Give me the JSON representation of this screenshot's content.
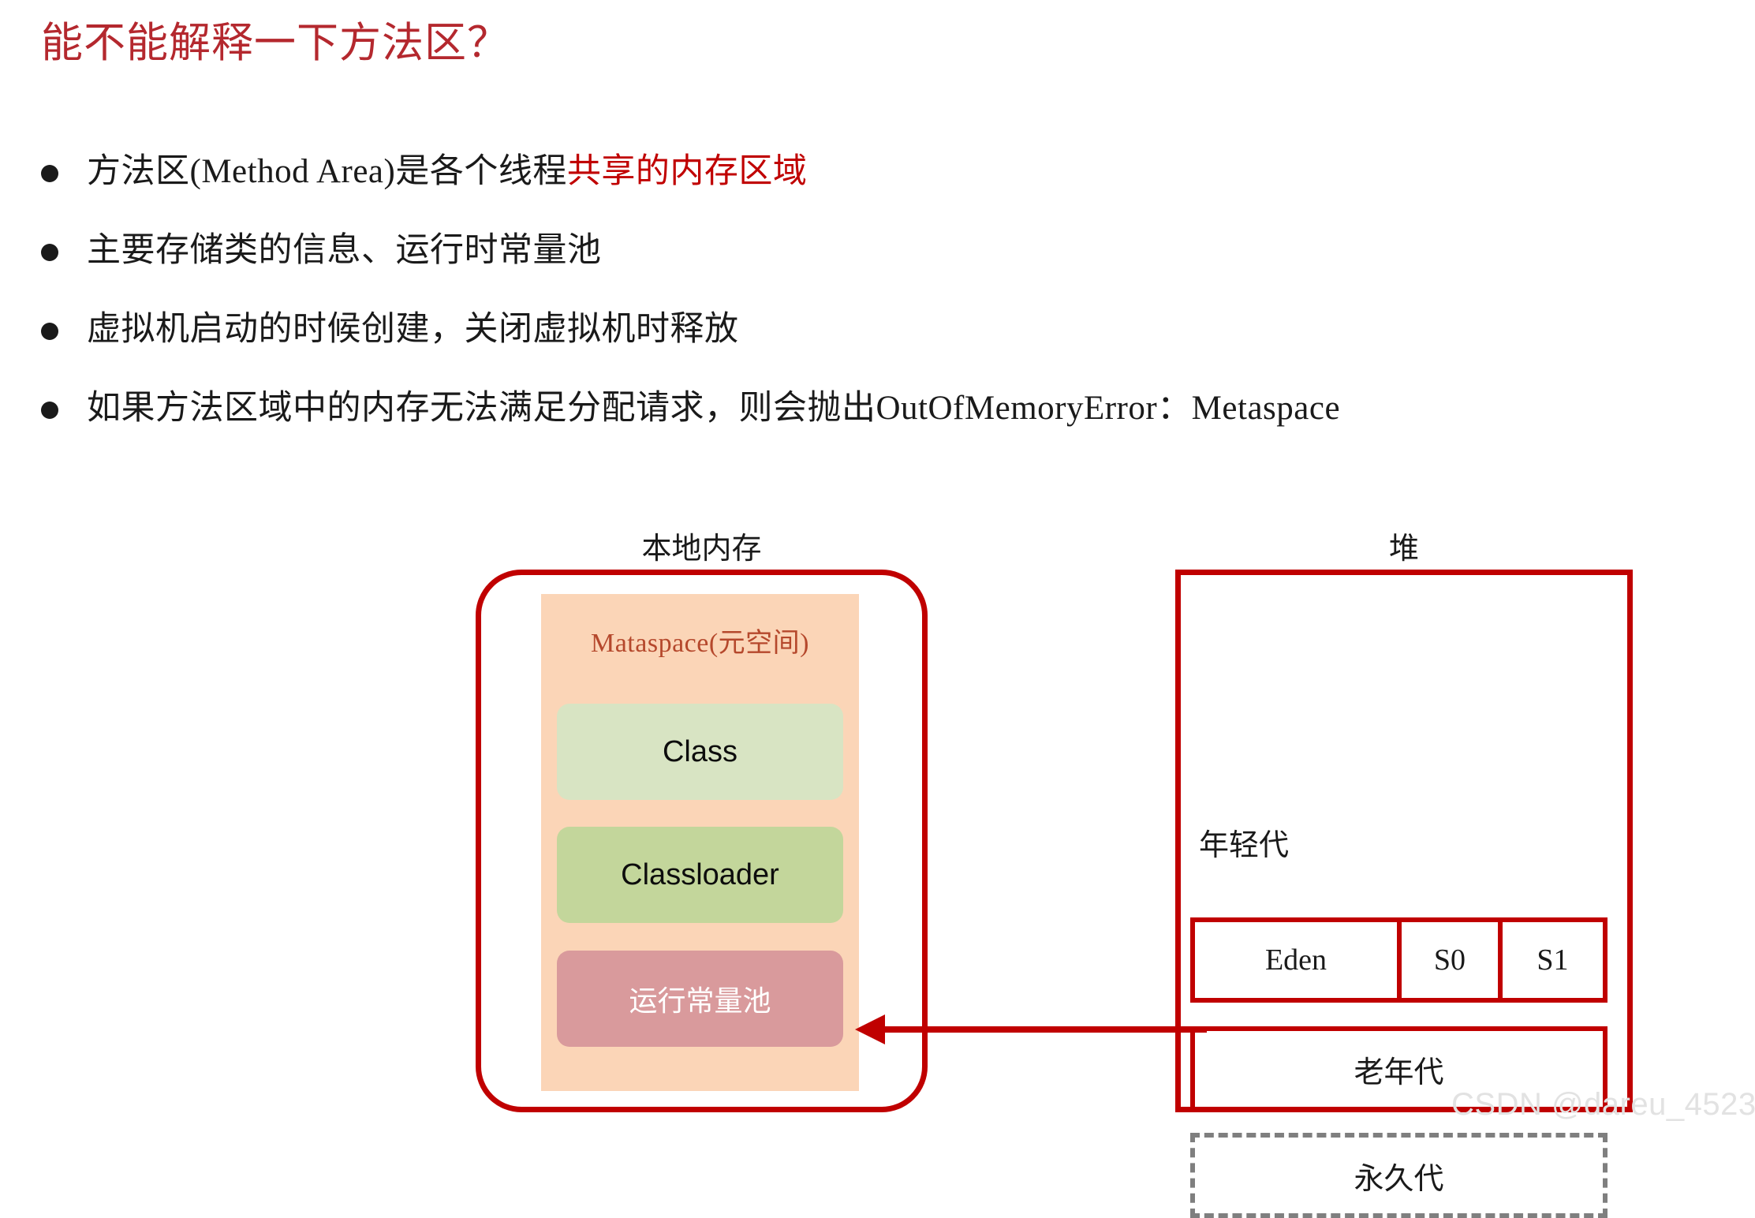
{
  "slide": {
    "title": "能不能解释一下方法区？",
    "title_color": "#b4282e"
  },
  "bullets": [
    {
      "text_main": "方法区(Method Area)是各个线程",
      "text_highlight": "共享的内存区域",
      "highlight_color": "#c00000"
    },
    {
      "text_main": "主要存储类的信息、运行时常量池",
      "text_highlight": "",
      "highlight_color": "#c00000"
    },
    {
      "text_main": "虚拟机启动的时候创建，关闭虚拟机时释放",
      "text_highlight": "",
      "highlight_color": "#c00000"
    },
    {
      "text_main": "如果方法区域中的内存无法满足分配请求，则会抛出OutOfMemoryError：Metaspace",
      "text_highlight": "",
      "highlight_color": "#c00000"
    }
  ],
  "diagram": {
    "native_memory": {
      "caption": "本地内存",
      "metaspace_label": "Mataspace(元空间)",
      "metaspace_label_color": "#b5482c",
      "panel_color": "#fbd5b7",
      "border_color": "#c00000",
      "items": [
        {
          "label": "Class",
          "color": "#d8e4c3"
        },
        {
          "label": "Classloader",
          "color": "#c3d69b"
        },
        {
          "label": "运行常量池",
          "color": "#d99a9c"
        }
      ]
    },
    "heap": {
      "caption": "堆",
      "border_color": "#c00000",
      "young_gen_label": "年轻代",
      "young_gen_cells": [
        "Eden",
        "S0",
        "S1"
      ],
      "old_gen_label": "老年代",
      "perm_gen_label": "永久代",
      "perm_gen_border_color": "#7f7f7f"
    },
    "arrow": {
      "color": "#c00000",
      "direction": "left"
    }
  },
  "watermark": {
    "text": "CSDN @dareu_4523"
  }
}
